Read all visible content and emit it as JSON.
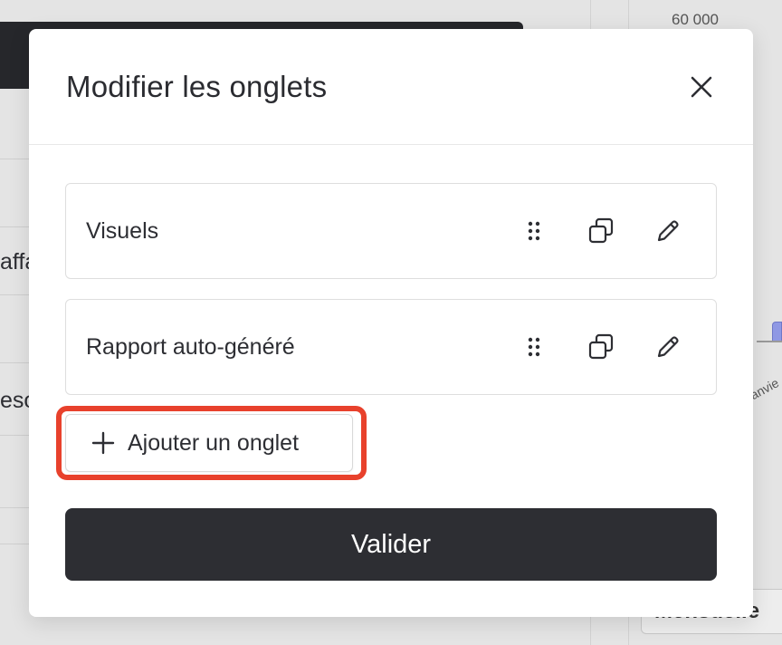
{
  "background": {
    "partial_text_1": "affa",
    "partial_text_2": "eso",
    "chart_tick": "60 000",
    "chart_axis_label": "anvie",
    "bottom_button": "Mensuelle"
  },
  "modal": {
    "title": "Modifier les onglets",
    "close_icon": "close-icon",
    "tabs": [
      {
        "label": "Visuels"
      },
      {
        "label": "Rapport auto-généré"
      }
    ],
    "tab_action_icons": [
      "drag-handle-icon",
      "duplicate-icon",
      "edit-pencil-icon"
    ],
    "add_tab_label": "Ajouter un onglet",
    "submit_label": "Valider"
  },
  "colors": {
    "primary_dark": "#2d2e33",
    "highlight": "#e8412c",
    "chart_bar": "#8f98e4"
  }
}
